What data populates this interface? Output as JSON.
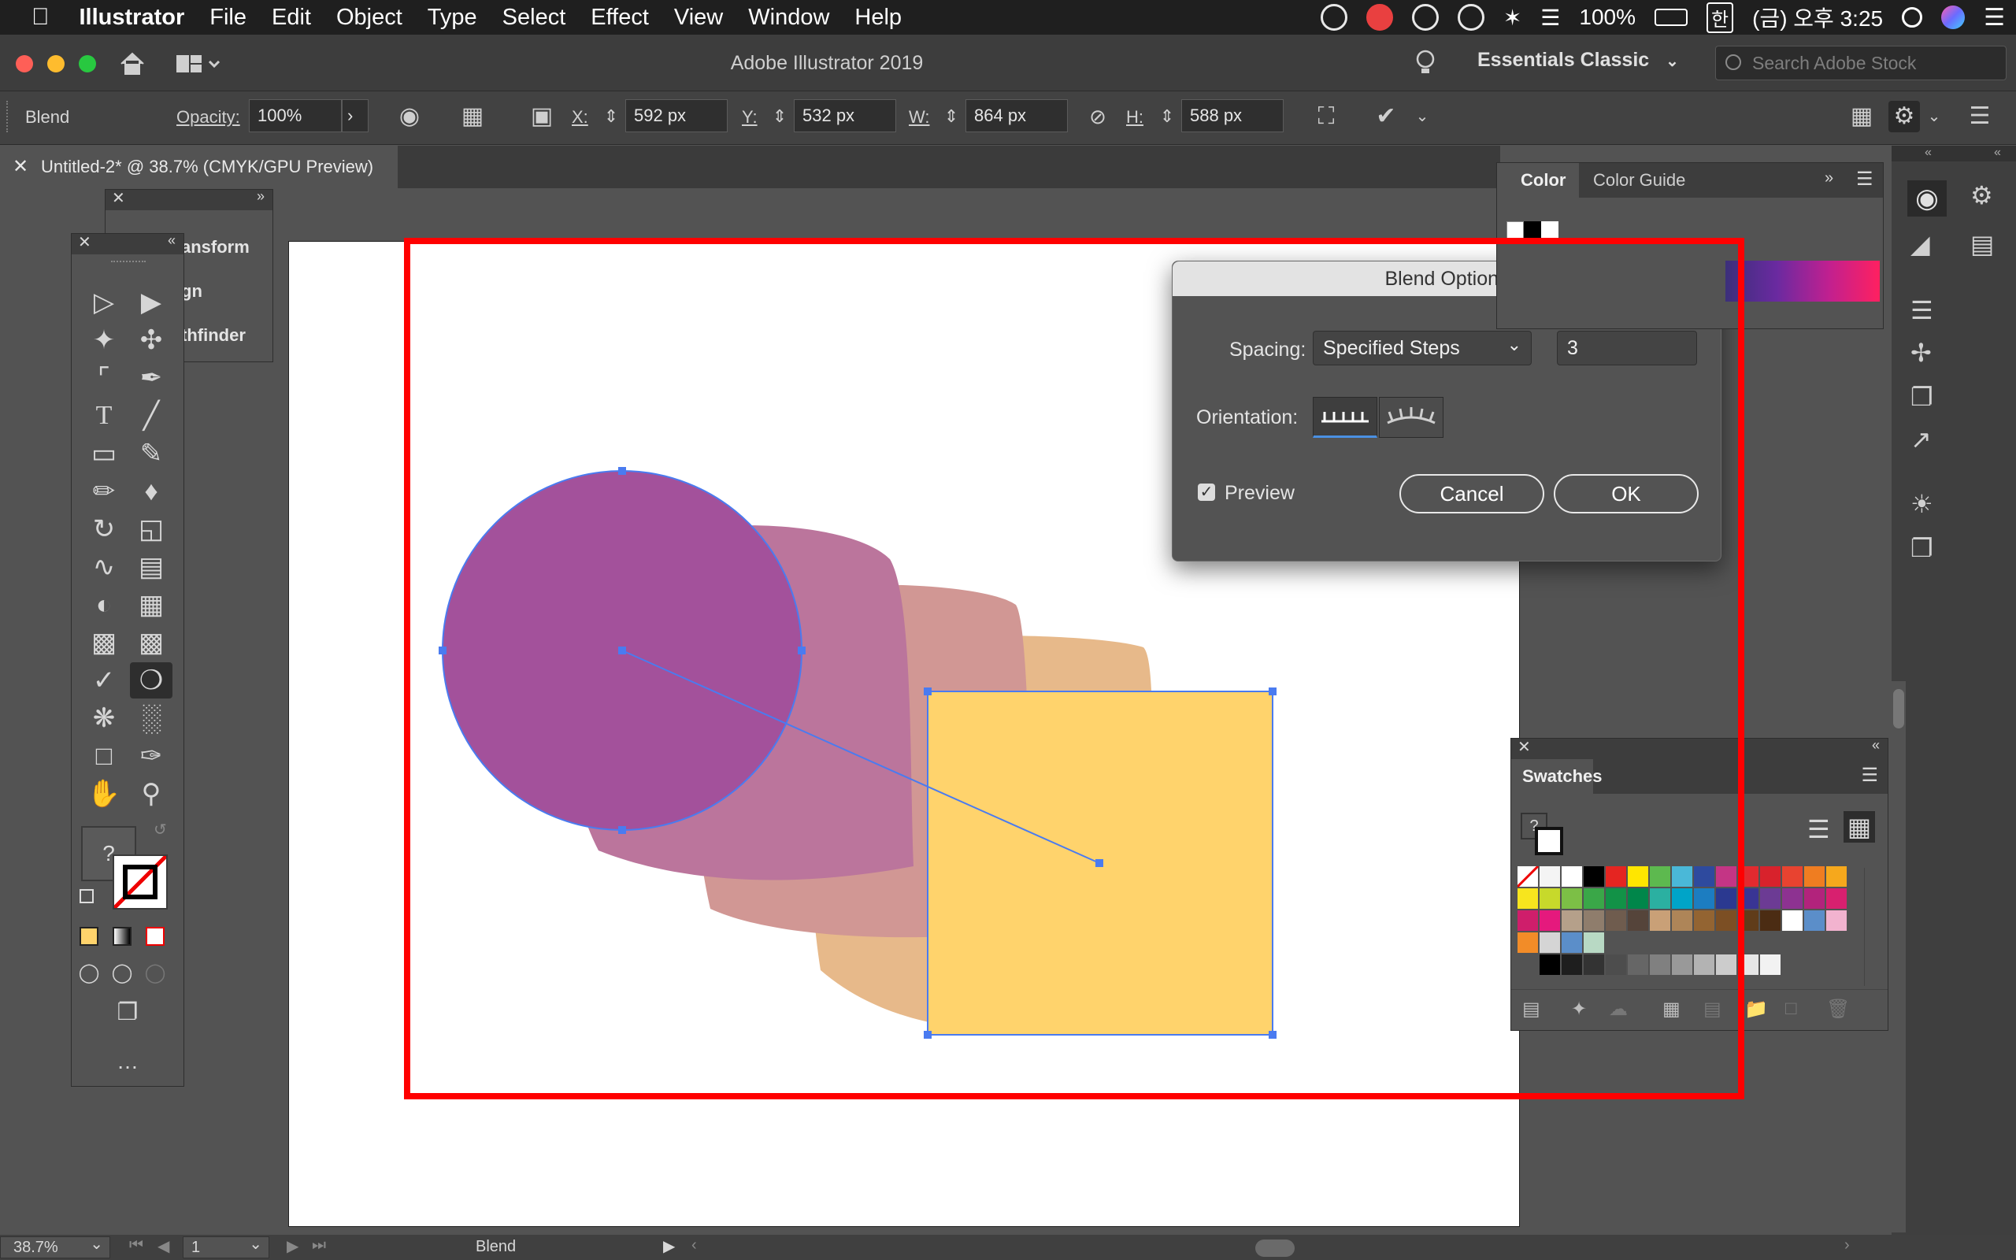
{
  "menubar": {
    "app": "Illustrator",
    "items": [
      "File",
      "Edit",
      "Object",
      "Type",
      "Select",
      "Effect",
      "View",
      "Window",
      "Help"
    ],
    "battery": "100%",
    "input_method": "한",
    "clock": "(금) 오후 3:25"
  },
  "titlebar": {
    "title": "Adobe Illustrator 2019",
    "workspace": "Essentials Classic",
    "search_placeholder": "Search Adobe Stock"
  },
  "control_bar": {
    "selection_label": "Blend",
    "opacity_label": "Opacity:",
    "opacity_value": "100%",
    "x_label": "X:",
    "x_value": "592 px",
    "y_label": "Y:",
    "y_value": "532 px",
    "w_label": "W:",
    "w_value": "864 px",
    "h_label": "H:",
    "h_value": "588 px"
  },
  "document_tab": {
    "title": "Untitled-2* @ 38.7% (CMYK/GPU Preview)"
  },
  "floating_panel": {
    "items": [
      "ansform",
      "gn",
      "thfinder"
    ]
  },
  "blend_dialog": {
    "title": "Blend Options",
    "spacing_label": "Spacing:",
    "spacing_value": "Specified Steps",
    "steps_value": "3",
    "orientation_label": "Orientation:",
    "preview_label": "Preview",
    "preview_checked": true,
    "cancel_label": "Cancel",
    "ok_label": "OK"
  },
  "color_panel": {
    "tabs": [
      "Color",
      "Color Guide"
    ]
  },
  "swatches_panel": {
    "title": "Swatches"
  },
  "status_bar": {
    "zoom": "38.7%",
    "artboard_number": "1",
    "tool_name": "Blend"
  },
  "colors": {
    "circle": "#a3519b",
    "step1": "#bb759c",
    "step2": "#d19794",
    "step3": "#e7b98a",
    "square": "#ffd36c",
    "selection": "#4a7bf0",
    "annotation_frame": "#ff0000"
  },
  "toolbox_tools": [
    "direct-select",
    "group-select",
    "magic-wand",
    "lasso",
    "anchor",
    "pen",
    "type",
    "line",
    "rectangle",
    "paintbrush",
    "pencil",
    "eraser",
    "rotate",
    "scale",
    "warp",
    "free-transform",
    "shape-builder",
    "perspective",
    "mesh",
    "gradient",
    "eyedropper",
    "blend",
    "symbol-sprayer",
    "column-graph",
    "artboard",
    "slice",
    "hand",
    "zoom"
  ]
}
